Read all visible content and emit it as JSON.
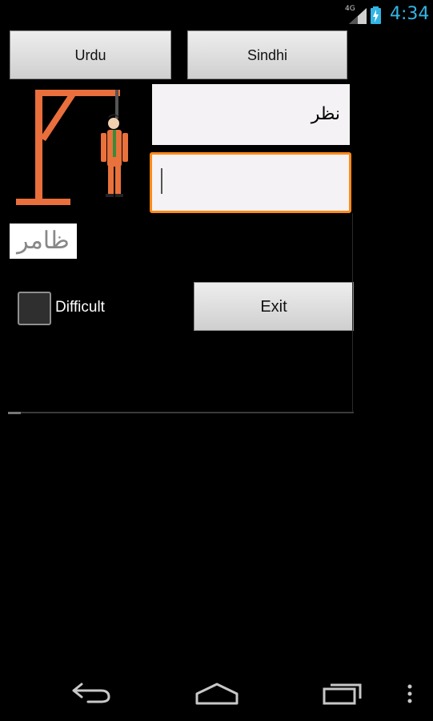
{
  "status_bar": {
    "network": "4G",
    "time": "4:34",
    "accent_color": "#33b5e5"
  },
  "language_buttons": {
    "urdu": "Urdu",
    "sindhi": "Sindhi"
  },
  "game": {
    "word_display": "نظر",
    "guess_input_value": "",
    "hint_text": "ظامر",
    "difficult_label": "Difficult",
    "difficult_checked": false,
    "exit_label": "Exit",
    "input_border_color": "#ff8a1a"
  },
  "nav_bar": {
    "icons": [
      "back-icon",
      "home-icon",
      "recent-apps-icon",
      "overflow-menu-icon"
    ]
  }
}
